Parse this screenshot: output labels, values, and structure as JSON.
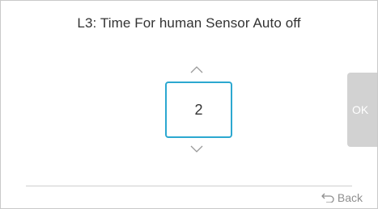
{
  "header": {
    "title": "L3: Time For human Sensor Auto off"
  },
  "stepper": {
    "value": "2",
    "up_icon": "chevron-up-icon",
    "down_icon": "chevron-down-icon"
  },
  "actions": {
    "ok_label": "OK",
    "back_label": "Back",
    "back_icon": "return-arrow-icon"
  },
  "colors": {
    "accent": "#2ca8d0",
    "ok_button_bg": "#d2d2d2",
    "text": "#333333",
    "muted_text": "#8f8f8f",
    "divider": "#cfcfcf"
  }
}
